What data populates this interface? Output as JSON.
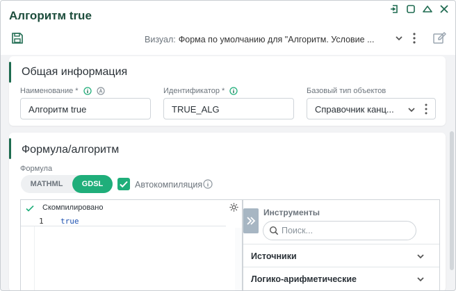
{
  "window": {
    "title": "Алгоритм true",
    "visual_label": "Визуал:",
    "visual_value": "Форма по умолчанию для \"Алгоритм. Условие ..."
  },
  "general": {
    "title": "Общая информация",
    "name_label": "Наименование *",
    "name_value": "Алгоритм true",
    "id_label": "Идентификатор *",
    "id_value": "TRUE_ALG",
    "base_type_label": "Базовый тип объектов",
    "base_type_value": "Справочник канц..."
  },
  "formula": {
    "title": "Формула/алгоритм",
    "formula_label": "Формула",
    "tabs": [
      "MATHML",
      "GDSL"
    ],
    "active_tab": "GDSL",
    "autocompile_label": "Автокомпиляция",
    "autocompile_checked": true
  },
  "editor": {
    "status": "Скомпилировано",
    "lines": [
      {
        "number": "1",
        "code": "true"
      }
    ]
  },
  "tools": {
    "title": "Инструменты",
    "search_placeholder": "Поиск...",
    "sections": [
      "Источники",
      "Логико-арифметические"
    ]
  },
  "colors": {
    "accent": "#1fae7a",
    "title_green": "#1d4d3c",
    "code_blue": "#1a4fb0"
  },
  "icons": [
    "save-icon",
    "minimize-icon",
    "maximize-icon",
    "pin-icon",
    "close-icon",
    "edit-icon",
    "info-icon",
    "gear-icon",
    "search-icon",
    "chevron-down-icon",
    "more-icon",
    "double-chevron-right-icon",
    "check-icon"
  ]
}
